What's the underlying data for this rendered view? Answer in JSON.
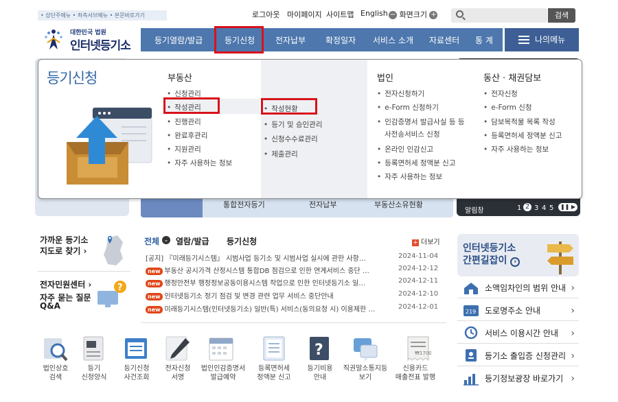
{
  "header": {
    "skip_links": "• 상단주메뉴 • 좌측서브메뉴 • 본문바로가기",
    "util": {
      "logout": "로그아웃",
      "mypage": "마이페이지",
      "sitemap": "사이트맵",
      "english": "English",
      "zoom_label": "화면크기"
    },
    "search": {
      "placeholder": "",
      "button": "검색"
    },
    "logo": {
      "sub": "대한민국 법원",
      "main": "인터넷등기소"
    }
  },
  "gnb": {
    "items": [
      "등기열람/발급",
      "등기신청",
      "전자납부",
      "확정일자",
      "서비스 소개",
      "자료센터",
      "통 계"
    ],
    "my_menu": "나의메뉴"
  },
  "mega": {
    "title": "등기신청",
    "col_real_estate": {
      "head": "부동산",
      "items": [
        "신청관리",
        "작성관리",
        "진행관리",
        "완료후관리",
        "지원관리",
        "자주 사용하는 정보"
      ]
    },
    "col_sub": {
      "items": [
        "작성현황",
        "등기 및 승인관리",
        "신청수수료관리",
        "제출관리"
      ]
    },
    "col_corp": {
      "head": "법인",
      "items": [
        "전자신청하기",
        "e-Form 신청하기",
        "인감증명서 발급사실 등 등",
        "사전송서비스 신청",
        "온라인 인감신고",
        "등록면허세 정액분 신고",
        "자주 사용하는 정보"
      ]
    },
    "col_movable": {
      "head": "동산 · 채권담보",
      "items": [
        "전자신청",
        "e-Form 신청",
        "담보목적물 목록 작성",
        "등록면허세 정액분 신고",
        "자주 사용하는 정보"
      ]
    }
  },
  "background": {
    "strip_labels": [
      "통합전자등기",
      "전자납부",
      "부동산소유현황"
    ],
    "pager": {
      "label": "알림창",
      "pages": [
        "1",
        "2",
        "3",
        "4",
        "5"
      ]
    }
  },
  "left_panel": {
    "nearby": {
      "line1": "가까운 등기소",
      "line2": "지도로 찾기 ›"
    },
    "center": {
      "line1": "전자민원센터 ›",
      "line2": "자주 묻는 질문",
      "line3": "Q&A"
    }
  },
  "news": {
    "tabs": [
      "전체",
      "열람/발급",
      "등기신청"
    ],
    "more": "더보기",
    "rows": [
      {
        "badge": "",
        "text": "[공지] 『미래등기시스템』 시범사업 등기소 및 시범사업 실시에 관한 사항…",
        "date": "2024-11-04"
      },
      {
        "badge": "new",
        "text": "부동산 공시가격 산정시스템 통합DB 점검으로 인한 연계서비스 중단 …",
        "date": "2024-12-12"
      },
      {
        "badge": "new",
        "text": "행정안전부 행정정보공동이용시스템 작업으로 인한 인터넷등기소 일…",
        "date": "2024-12-11"
      },
      {
        "badge": "new",
        "text": "인터넷등기소 정기 점검 및 변경 관련 업무 서비스 중단안내",
        "date": "2024-12-10"
      },
      {
        "badge": "new",
        "text": "미래등기시스템(인터넷등기소) 일반(특) 서비스(동의요청 시) 이용제한 …",
        "date": "2024-12-01"
      }
    ]
  },
  "quick": [
    {
      "l1": "법인상호",
      "l2": "검색"
    },
    {
      "l1": "등기",
      "l2": "신청양식"
    },
    {
      "l1": "등기신청",
      "l2": "사건조회"
    },
    {
      "l1": "전자신청",
      "l2": "서명"
    },
    {
      "l1": "법인인감증명서",
      "l2": "발급예약"
    },
    {
      "l1": "등록면허세",
      "l2": "정액분 신고"
    },
    {
      "l1": "등기비용",
      "l2": "안내"
    },
    {
      "l1": "직권말소통지등",
      "l2": "보기"
    },
    {
      "l1": "신용카드",
      "l2": "매출전표 발행"
    }
  ],
  "right": {
    "banner": {
      "line1": "인터넷등기소",
      "line2": "간편길잡이"
    },
    "links": [
      "소액임차인의 범위 안내",
      "도로명주소 안내",
      "서비스 이용시간 안내",
      "등기소 출입증 신청관리",
      "등기정보광장 바로가기"
    ]
  },
  "colors": {
    "accent": "#4d77ad",
    "highlight": "#d8121b",
    "title": "#3468a8"
  }
}
